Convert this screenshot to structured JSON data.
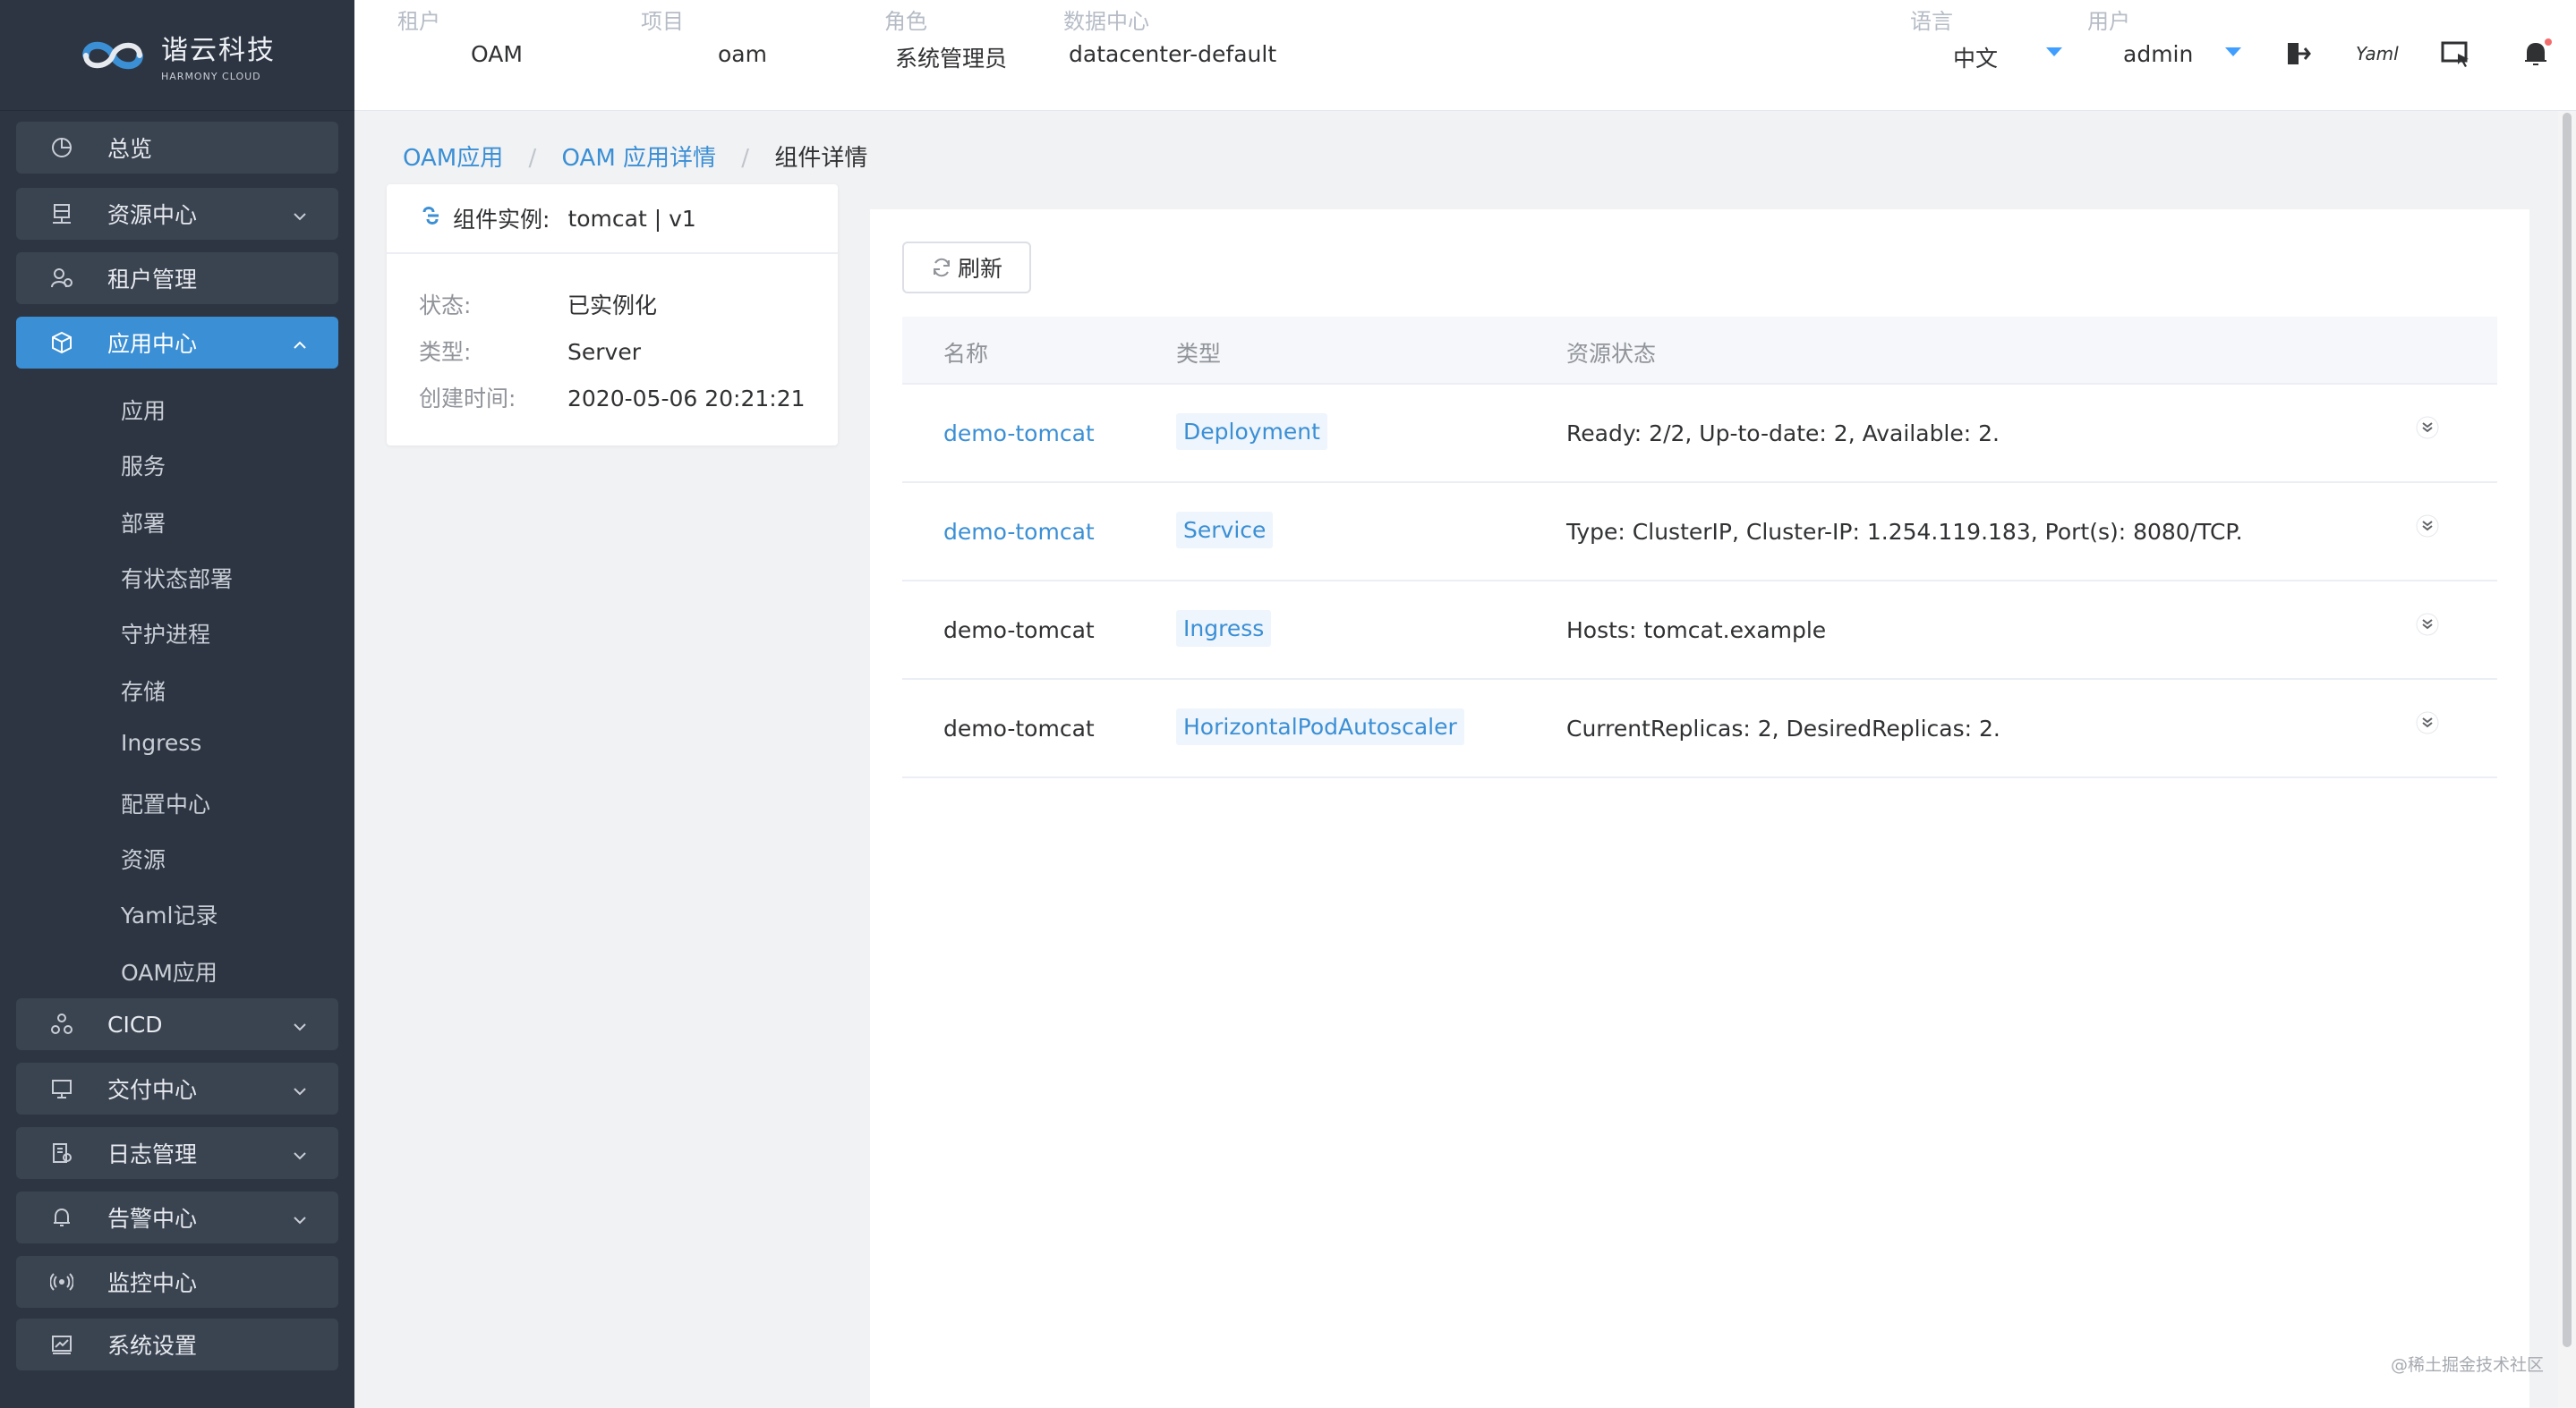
{
  "brand": {
    "name_cn": "谐云科技",
    "name_en": "HARMONY CLOUD"
  },
  "sidebar": {
    "menu": [
      {
        "label": "总览",
        "icon": "pie-chart-icon",
        "has_children": false,
        "active": false
      },
      {
        "label": "资源中心",
        "icon": "server-icon",
        "has_children": true,
        "active": false
      },
      {
        "label": "租户管理",
        "icon": "users-icon",
        "has_children": false,
        "active": false
      },
      {
        "label": "应用中心",
        "icon": "cube-icon",
        "has_children": true,
        "active": true
      },
      {
        "label": "CICD",
        "icon": "cicd-icon",
        "has_children": true,
        "active": false
      },
      {
        "label": "交付中心",
        "icon": "monitor-icon",
        "has_children": true,
        "active": false
      },
      {
        "label": "日志管理",
        "icon": "log-icon",
        "has_children": true,
        "active": false
      },
      {
        "label": "告警中心",
        "icon": "bell-icon",
        "has_children": true,
        "active": false
      },
      {
        "label": "监控中心",
        "icon": "signal-icon",
        "has_children": false,
        "active": false
      },
      {
        "label": "系统设置",
        "icon": "settings-chart-icon",
        "has_children": false,
        "active": false
      }
    ],
    "submenu": [
      "应用",
      "服务",
      "部署",
      "有状态部署",
      "守护进程",
      "存储",
      "Ingress",
      "配置中心",
      "资源",
      "Yaml记录",
      "OAM应用"
    ]
  },
  "header": {
    "tenant": {
      "label": "租户",
      "value": "OAM"
    },
    "project": {
      "label": "项目",
      "value": "oam"
    },
    "role": {
      "label": "角色",
      "value": "系统管理员"
    },
    "datacenter": {
      "label": "数据中心",
      "value": "datacenter-default"
    },
    "language": {
      "label": "语言",
      "value": "中文"
    },
    "user": {
      "label": "用户",
      "value": "admin"
    },
    "yaml_icon_text": "Yaml"
  },
  "breadcrumb": {
    "items": [
      "OAM应用",
      "OAM 应用详情"
    ],
    "current": "组件详情"
  },
  "component": {
    "title_label": "组件实例:",
    "title_value": "tomcat | v1",
    "status_label": "状态:",
    "status_value": "已实例化",
    "type_label": "类型:",
    "type_value": "Server",
    "created_label": "创建时间:",
    "created_value": "2020-05-06 20:21:21"
  },
  "toolbar": {
    "refresh_label": "刷新"
  },
  "table": {
    "columns": [
      "名称",
      "类型",
      "资源状态"
    ],
    "rows": [
      {
        "name": "demo-tomcat",
        "name_link": true,
        "type": "Deployment",
        "status": "Ready: 2/2, Up-to-date: 2, Available: 2."
      },
      {
        "name": "demo-tomcat",
        "name_link": true,
        "type": "Service",
        "status": "Type: ClusterIP, Cluster-IP: 1.254.119.183, Port(s): 8080/TCP."
      },
      {
        "name": "demo-tomcat",
        "name_link": false,
        "type": "Ingress",
        "status": "Hosts: tomcat.example"
      },
      {
        "name": "demo-tomcat",
        "name_link": false,
        "type": "HorizontalPodAutoscaler",
        "status": "CurrentReplicas: 2, DesiredReplicas: 2."
      }
    ]
  },
  "watermark": "@稀土掘金技术社区",
  "colors": {
    "sidebar_bg": "#2d3542",
    "menu_item_bg": "#3a4350",
    "accent": "#3b8fd5",
    "header_bg": "#ffffff"
  }
}
